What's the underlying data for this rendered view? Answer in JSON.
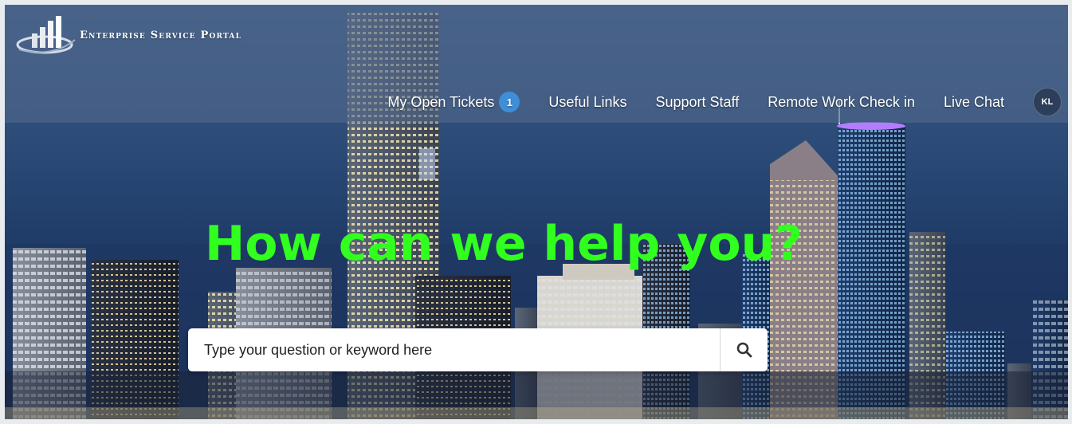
{
  "brand": {
    "name": "Enterprise Service Portal"
  },
  "nav": {
    "items": [
      {
        "label": "My Open Tickets",
        "badge": "1"
      },
      {
        "label": "Useful Links"
      },
      {
        "label": "Support Staff"
      },
      {
        "label": "Remote Work Check in"
      },
      {
        "label": "Live Chat"
      }
    ],
    "avatar_initials": "KL"
  },
  "hero": {
    "headline": "How can we help you?"
  },
  "search": {
    "placeholder": "Type your question or keyword here"
  },
  "colors": {
    "headline": "#31ff1e",
    "badge": "#3f8fd8",
    "avatar": "#2c3e5a"
  },
  "icons": {
    "search": "search-icon",
    "logo": "logo-icon"
  }
}
